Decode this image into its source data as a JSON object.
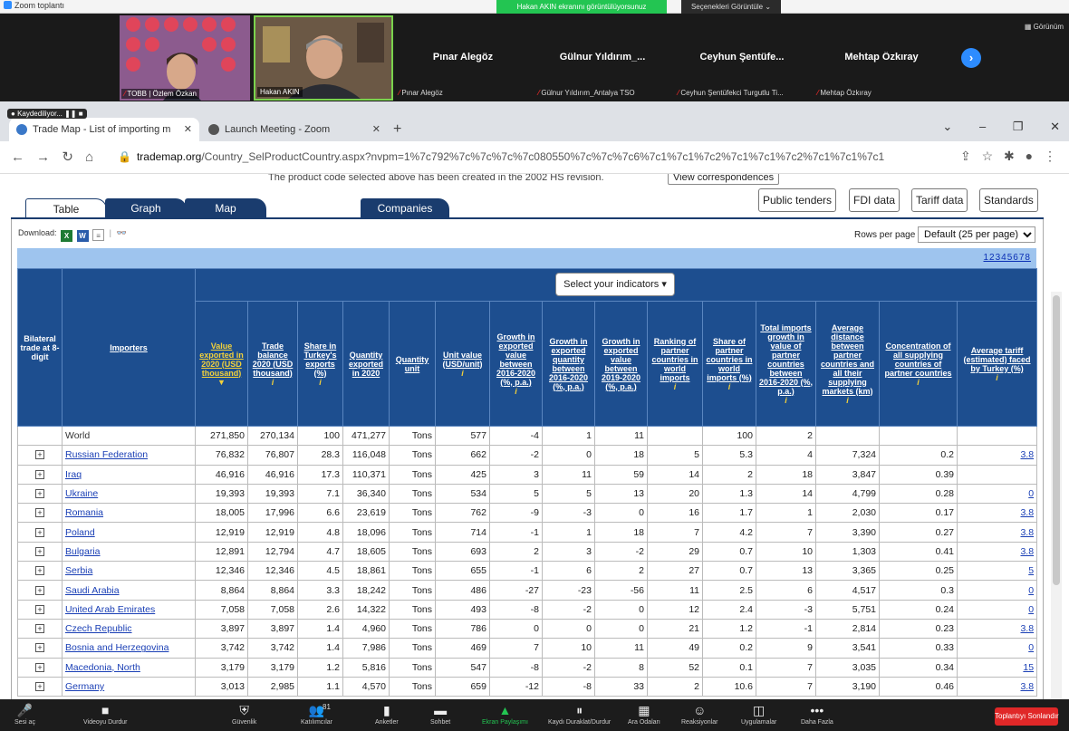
{
  "zoom": {
    "window_title": "Zoom toplantı",
    "share_banner": "Hakan AKIN ekranını görüntülüyorsunuz",
    "view_options": "Seçenekleri Görüntüle",
    "recording": "Kaydediliyor...",
    "view_label": "Görünüm",
    "participants": [
      {
        "name": "TOBB | Özlem Özkan"
      },
      {
        "name": "Hakan AKIN"
      },
      {
        "display": "Pınar Alegöz",
        "label": "Pınar Alegöz"
      },
      {
        "display": "Gülnur Yıldırım_...",
        "label": "Gülnur Yıldırım_Antalya TSO"
      },
      {
        "display": "Ceyhun Şentüfe...",
        "label": "Ceyhun Şentüfekci Turgutlu Ti..."
      },
      {
        "display": "Mehtap Özkıray",
        "label": "Mehtap Özkıray"
      }
    ],
    "toolbar": [
      {
        "icon": "mic-muted-icon",
        "glyph": "🎤",
        "label": "Sesi aç"
      },
      {
        "icon": "video-icon",
        "glyph": "■",
        "label": "Videoyu Durdur"
      },
      {
        "icon": "shield-icon",
        "glyph": "⛨",
        "label": "Güvenlik"
      },
      {
        "icon": "participants-icon",
        "glyph": "👥",
        "label": "Katılımcılar",
        "count": "81"
      },
      {
        "icon": "polls-icon",
        "glyph": "▮",
        "label": "Anketler"
      },
      {
        "icon": "chat-icon",
        "glyph": "▬",
        "label": "Sohbet"
      },
      {
        "icon": "share-screen-icon",
        "glyph": "▲",
        "label": "Ekran Paylaşımı"
      },
      {
        "icon": "pause-record-icon",
        "glyph": "⏸",
        "label": "Kaydı Duraklat/Durdur"
      },
      {
        "icon": "breakout-icon",
        "glyph": "▦",
        "label": "Ara Odaları"
      },
      {
        "icon": "reactions-icon",
        "glyph": "☺",
        "label": "Reaksiyonlar"
      },
      {
        "icon": "apps-icon",
        "glyph": "◫",
        "label": "Uygulamalar"
      },
      {
        "icon": "more-icon",
        "glyph": "•••",
        "label": "Daha Fazla"
      }
    ],
    "end_button": "Toplantıyı Sonlandır"
  },
  "browser": {
    "tab1": "Trade Map - List of importing m",
    "tab2": "Launch Meeting - Zoom",
    "url_host": "trademap.org",
    "url_path": "/Country_SelProductCountry.aspx?nvpm=1%7c792%7c%7c%7c%7c080550%7c%7c%7c6%7c1%7c1%7c2%7c1%7c1%7c2%7c1%7c1%7c1"
  },
  "trademap": {
    "notice": "The product code selected above has been created in the 2002 HS revision.",
    "view_correspondences": "View correspondences",
    "tabs": {
      "table": "Table",
      "graph": "Graph",
      "map": "Map",
      "companies": "Companies"
    },
    "buttons": {
      "public_tenders": "Public tenders",
      "fdi": "FDI data",
      "tariff": "Tariff data",
      "standards": "Standards"
    },
    "download_label": "Download:",
    "rows_per_page_label": "Rows per page",
    "rows_per_page_value": "Default (25 per page)",
    "pages": "12345678",
    "select_indicators": "Select your indicators ▾",
    "headers": {
      "bilateral": "Bilateral trade at 8-digit",
      "importers": "Importers",
      "value": "Value exported in 2020 (USD thousand)",
      "balance": "Trade balance 2020 (USD thousand)",
      "share": "Share in Turkey's exports (%)",
      "quantity": "Quantity exported in 2020",
      "qunit": "Quantity unit",
      "unitvalue": "Unit value (USD/unit)",
      "gvalue": "Growth in exported value between 2016-2020 (%, p.a.)",
      "gqty": "Growth in exported quantity between 2016-2020 (%, p.a.)",
      "gvalue2": "Growth in exported value between 2019-2020 (%, p.a.)",
      "ranking": "Ranking of partner countries in world imports",
      "sharew": "Share of partner countries in world imports (%)",
      "totalgrowth": "Total imports growth in value of partner countries between 2016-2020 (%, p.a.)",
      "distance": "Average distance between partner countries and all their supplying markets (km)",
      "concentration": "Concentration of all supplying countries of partner countries",
      "tariff": "Average tariff (estimated) faced by Turkey (%)"
    },
    "rows": [
      [
        "World",
        "271,850",
        "270,134",
        "100",
        "471,277",
        "Tons",
        "577",
        "-4",
        "1",
        "11",
        "",
        "100",
        "2",
        "",
        "",
        ""
      ],
      [
        "Russian Federation",
        "76,832",
        "76,807",
        "28.3",
        "116,048",
        "Tons",
        "662",
        "-2",
        "0",
        "18",
        "5",
        "5.3",
        "4",
        "7,324",
        "0.2",
        "3.8"
      ],
      [
        "Iraq",
        "46,916",
        "46,916",
        "17.3",
        "110,371",
        "Tons",
        "425",
        "3",
        "11",
        "59",
        "14",
        "2",
        "18",
        "3,847",
        "0.39",
        ""
      ],
      [
        "Ukraine",
        "19,393",
        "19,393",
        "7.1",
        "36,340",
        "Tons",
        "534",
        "5",
        "5",
        "13",
        "20",
        "1.3",
        "14",
        "4,799",
        "0.28",
        "0"
      ],
      [
        "Romania",
        "18,005",
        "17,996",
        "6.6",
        "23,619",
        "Tons",
        "762",
        "-9",
        "-3",
        "0",
        "16",
        "1.7",
        "1",
        "2,030",
        "0.17",
        "3.8"
      ],
      [
        "Poland",
        "12,919",
        "12,919",
        "4.8",
        "18,096",
        "Tons",
        "714",
        "-1",
        "1",
        "18",
        "7",
        "4.2",
        "7",
        "3,390",
        "0.27",
        "3.8"
      ],
      [
        "Bulgaria",
        "12,891",
        "12,794",
        "4.7",
        "18,605",
        "Tons",
        "693",
        "2",
        "3",
        "-2",
        "29",
        "0.7",
        "10",
        "1,303",
        "0.41",
        "3.8"
      ],
      [
        "Serbia",
        "12,346",
        "12,346",
        "4.5",
        "18,861",
        "Tons",
        "655",
        "-1",
        "6",
        "2",
        "27",
        "0.7",
        "13",
        "3,365",
        "0.25",
        "5"
      ],
      [
        "Saudi Arabia",
        "8,864",
        "8,864",
        "3.3",
        "18,242",
        "Tons",
        "486",
        "-27",
        "-23",
        "-56",
        "11",
        "2.5",
        "6",
        "4,517",
        "0.3",
        "0"
      ],
      [
        "United Arab Emirates",
        "7,058",
        "7,058",
        "2.6",
        "14,322",
        "Tons",
        "493",
        "-8",
        "-2",
        "0",
        "12",
        "2.4",
        "-3",
        "5,751",
        "0.24",
        "0"
      ],
      [
        "Czech Republic",
        "3,897",
        "3,897",
        "1.4",
        "4,960",
        "Tons",
        "786",
        "0",
        "0",
        "0",
        "21",
        "1.2",
        "-1",
        "2,814",
        "0.23",
        "3.8"
      ],
      [
        "Bosnia and Herzegovina",
        "3,742",
        "3,742",
        "1.4",
        "7,986",
        "Tons",
        "469",
        "7",
        "10",
        "11",
        "49",
        "0.2",
        "9",
        "3,541",
        "0.33",
        "0"
      ],
      [
        "Macedonia, North",
        "3,179",
        "3,179",
        "1.2",
        "5,816",
        "Tons",
        "547",
        "-8",
        "-2",
        "8",
        "52",
        "0.1",
        "7",
        "3,035",
        "0.34",
        "15"
      ],
      [
        "Germany",
        "3,013",
        "2,985",
        "1.1",
        "4,570",
        "Tons",
        "659",
        "-12",
        "-8",
        "33",
        "2",
        "10.6",
        "7",
        "3,190",
        "0.46",
        "3.8"
      ]
    ]
  }
}
